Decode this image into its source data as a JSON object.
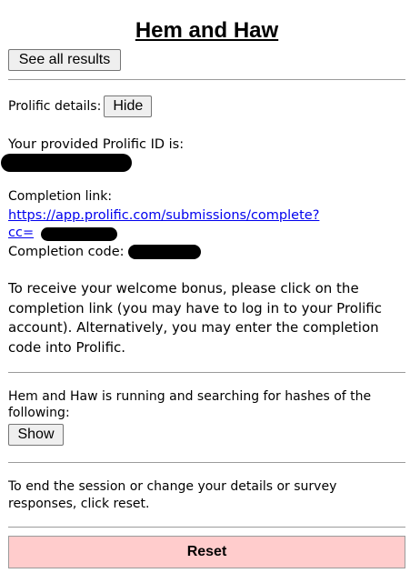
{
  "title": "Hem and Haw",
  "see_all_results": "See all results",
  "prolific": {
    "label": "Prolific details:",
    "toggle": "Hide",
    "id_label": "Your provided Prolific ID is:",
    "completion_link_label": "Completion link:",
    "completion_link_text": "https://app.prolific.com/submissions/complete?cc=",
    "completion_code_label": "Completion code:",
    "welcome_bonus_text": "To receive your welcome bonus, please click on the completion link (you may have to log in to your Prolific account). Alternatively, you may enter the completion code into Prolific."
  },
  "hashes": {
    "text": "Hem and Haw is running and searching for hashes of the following:",
    "toggle": "Show"
  },
  "reset_section": {
    "text": "To end the session or change your details or survey responses, click reset.",
    "button": "Reset"
  }
}
